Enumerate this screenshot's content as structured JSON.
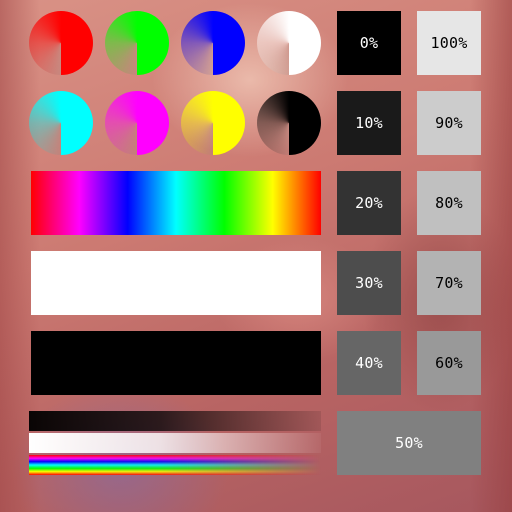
{
  "test_pattern": {
    "color_wheels": [
      {
        "name": "red",
        "color": "#ff0000"
      },
      {
        "name": "green",
        "color": "#00ff00"
      },
      {
        "name": "blue",
        "color": "#0000ff"
      },
      {
        "name": "white",
        "color": "#ffffff"
      },
      {
        "name": "cyan",
        "color": "#00ffff"
      },
      {
        "name": "magenta",
        "color": "#ff00ff"
      },
      {
        "name": "yellow",
        "color": "#ffff00"
      },
      {
        "name": "black",
        "color": "#000000"
      }
    ],
    "bars": {
      "hue_stops": [
        "#ff0000",
        "#ff00ff",
        "#0000ff",
        "#00ffff",
        "#00ff00",
        "#ffff00",
        "#ff0000"
      ],
      "white": "#ffffff",
      "black": "#000000"
    },
    "gray_swatches": [
      {
        "label": "0%",
        "value": 0,
        "color": "#000000",
        "text_color": "#ffffff"
      },
      {
        "label": "100%",
        "value": 100,
        "color": "#e6e6e6",
        "text_color": "#000000"
      },
      {
        "label": "10%",
        "value": 10,
        "color": "#1a1a1a",
        "text_color": "#ffffff"
      },
      {
        "label": "90%",
        "value": 90,
        "color": "#cccccc",
        "text_color": "#000000"
      },
      {
        "label": "20%",
        "value": 20,
        "color": "#333333",
        "text_color": "#ffffff"
      },
      {
        "label": "80%",
        "value": 80,
        "color": "#c0c0c0",
        "text_color": "#000000"
      },
      {
        "label": "30%",
        "value": 30,
        "color": "#4d4d4d",
        "text_color": "#ffffff"
      },
      {
        "label": "70%",
        "value": 70,
        "color": "#b3b3b3",
        "text_color": "#000000"
      },
      {
        "label": "40%",
        "value": 40,
        "color": "#666666",
        "text_color": "#ffffff"
      },
      {
        "label": "60%",
        "value": 60,
        "color": "#999999",
        "text_color": "#000000"
      },
      {
        "label": "50%",
        "value": 50,
        "color": "#808080",
        "text_color": "#ffffff"
      }
    ]
  }
}
